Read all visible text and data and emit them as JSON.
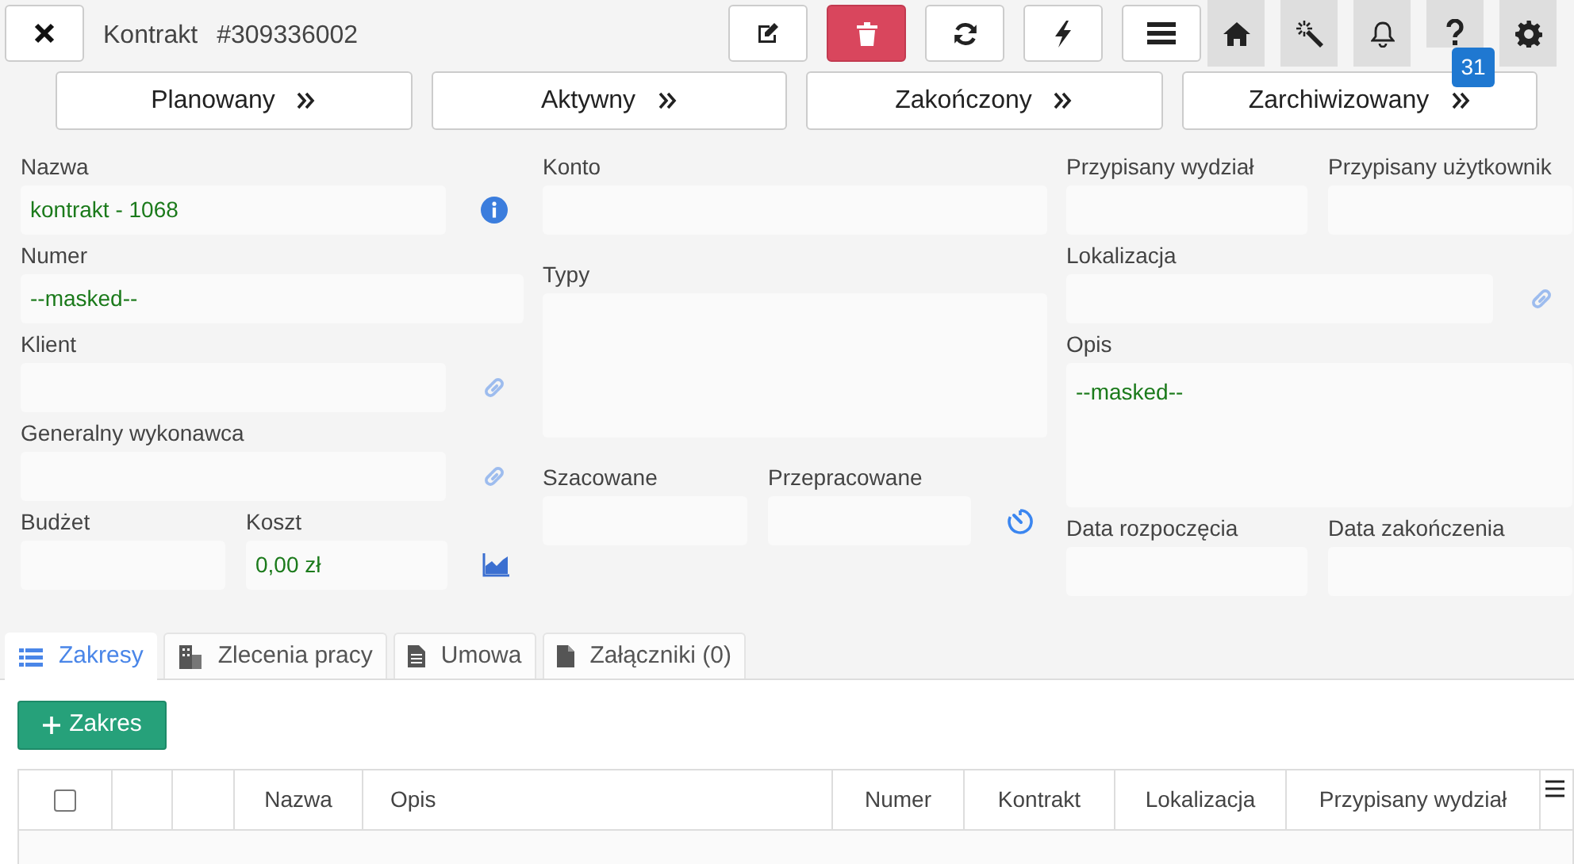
{
  "header": {
    "title": "Kontrakt",
    "number": "#309336002"
  },
  "toolbar": [
    {
      "kind": "edit"
    },
    {
      "kind": "delete"
    },
    {
      "kind": "refresh"
    },
    {
      "kind": "bolt"
    },
    {
      "kind": "menu"
    }
  ],
  "nav_icons": [
    {
      "kind": "home"
    },
    {
      "kind": "wand"
    },
    {
      "kind": "bell"
    },
    {
      "kind": "help",
      "badge": "31"
    },
    {
      "kind": "gear"
    }
  ],
  "status_buttons": [
    "Planowany",
    "Aktywny",
    "Zakończony",
    "Zarchiwizowany"
  ],
  "form": {
    "columns": [
      [
        {
          "fields": [
            {
              "label": "Nazwa",
              "value": "kontrakt - 1068"
            }
          ],
          "kind": "info"
        },
        {
          "fields": [
            {
              "label": "Numer",
              "value": "--masked--"
            }
          ]
        },
        {
          "fields": [
            {
              "label": "Klient"
            }
          ],
          "kind": "link"
        },
        {
          "fields": [
            {
              "label": "Generalny wykonawca"
            }
          ],
          "kind": "link"
        },
        {
          "fields": [
            {
              "label": "Budżet"
            },
            {
              "label": "Koszt",
              "value": "0,00 zł"
            }
          ],
          "kind": "chart"
        }
      ],
      [
        {
          "fields": [
            {
              "label": "Konto"
            }
          ]
        },
        {
          "fields": [
            {
              "label": "Typy",
              "kind": "textarea"
            }
          ]
        },
        {
          "fields": [
            {
              "label": "Szacowane"
            },
            {
              "label": "Przepracowane"
            }
          ],
          "kind": "timer"
        }
      ],
      [
        {
          "fields": [
            {
              "label": "Przypisany wydział"
            },
            {
              "label": "Przypisany użytkownik"
            }
          ]
        },
        {
          "fields": [
            {
              "label": "Lokalizacja"
            }
          ],
          "kind": "link"
        },
        {
          "fields": [
            {
              "label": "Opis",
              "value": "--masked--",
              "kind": "textarea"
            }
          ]
        },
        {
          "fields": [
            {
              "label": "Data rozpoczęcia"
            },
            {
              "label": "Data zakończenia"
            }
          ]
        }
      ]
    ]
  },
  "tabs": [
    {
      "label": "Zakresy",
      "kind": "list",
      "selected": true
    },
    {
      "label": "Zlecenia pracy",
      "kind": "building",
      "selected": false
    },
    {
      "label": "Umowa",
      "kind": "doc",
      "selected": false
    },
    {
      "label": "Załączniki (0)",
      "kind": "file",
      "selected": false
    }
  ],
  "add_button": "Zakres",
  "table": {
    "select_all_checked": false,
    "columns": [
      "Nazwa",
      "Opis",
      "Numer",
      "Kontrakt",
      "Lokalizacja",
      "Przypisany wydział"
    ]
  }
}
